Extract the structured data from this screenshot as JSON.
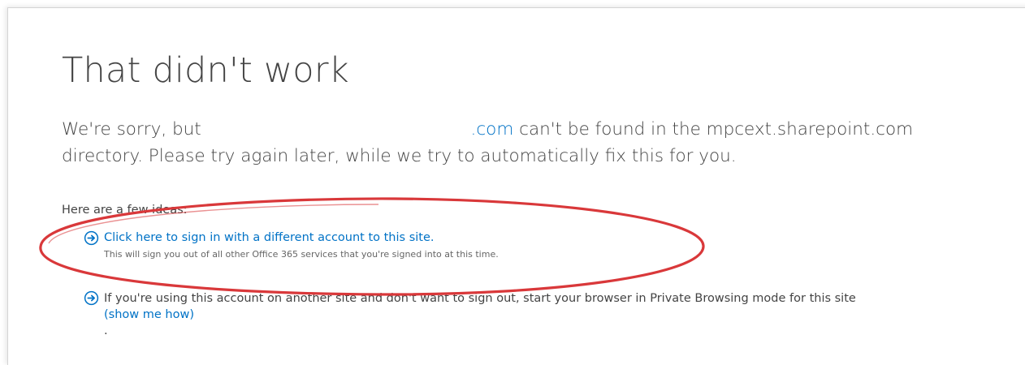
{
  "page": {
    "title": "That didn't work",
    "message_part1": "We're sorry, but ",
    "message_domain": ".com",
    "message_part2": " can't be found in the mpcext.sharepoint.com directory. Please try again later, while we try to automatically fix this for you."
  },
  "ideas": {
    "label": "Here are a few ideas:",
    "items": [
      {
        "icon": "arrow-circle-right-icon",
        "link": "Click here to sign in with a different account to this site.",
        "note": "This will sign you out of all other Office 365 services that you're signed into at this time."
      },
      {
        "icon": "arrow-circle-right-icon",
        "text": "If you're using this account on another site and don't want to sign out, start your browser in Private Browsing mode for this site ",
        "link": "(show me how)",
        "after": "."
      }
    ]
  },
  "colors": {
    "link": "#0072c6",
    "text": "#444444",
    "annotation": "#d9383a"
  }
}
